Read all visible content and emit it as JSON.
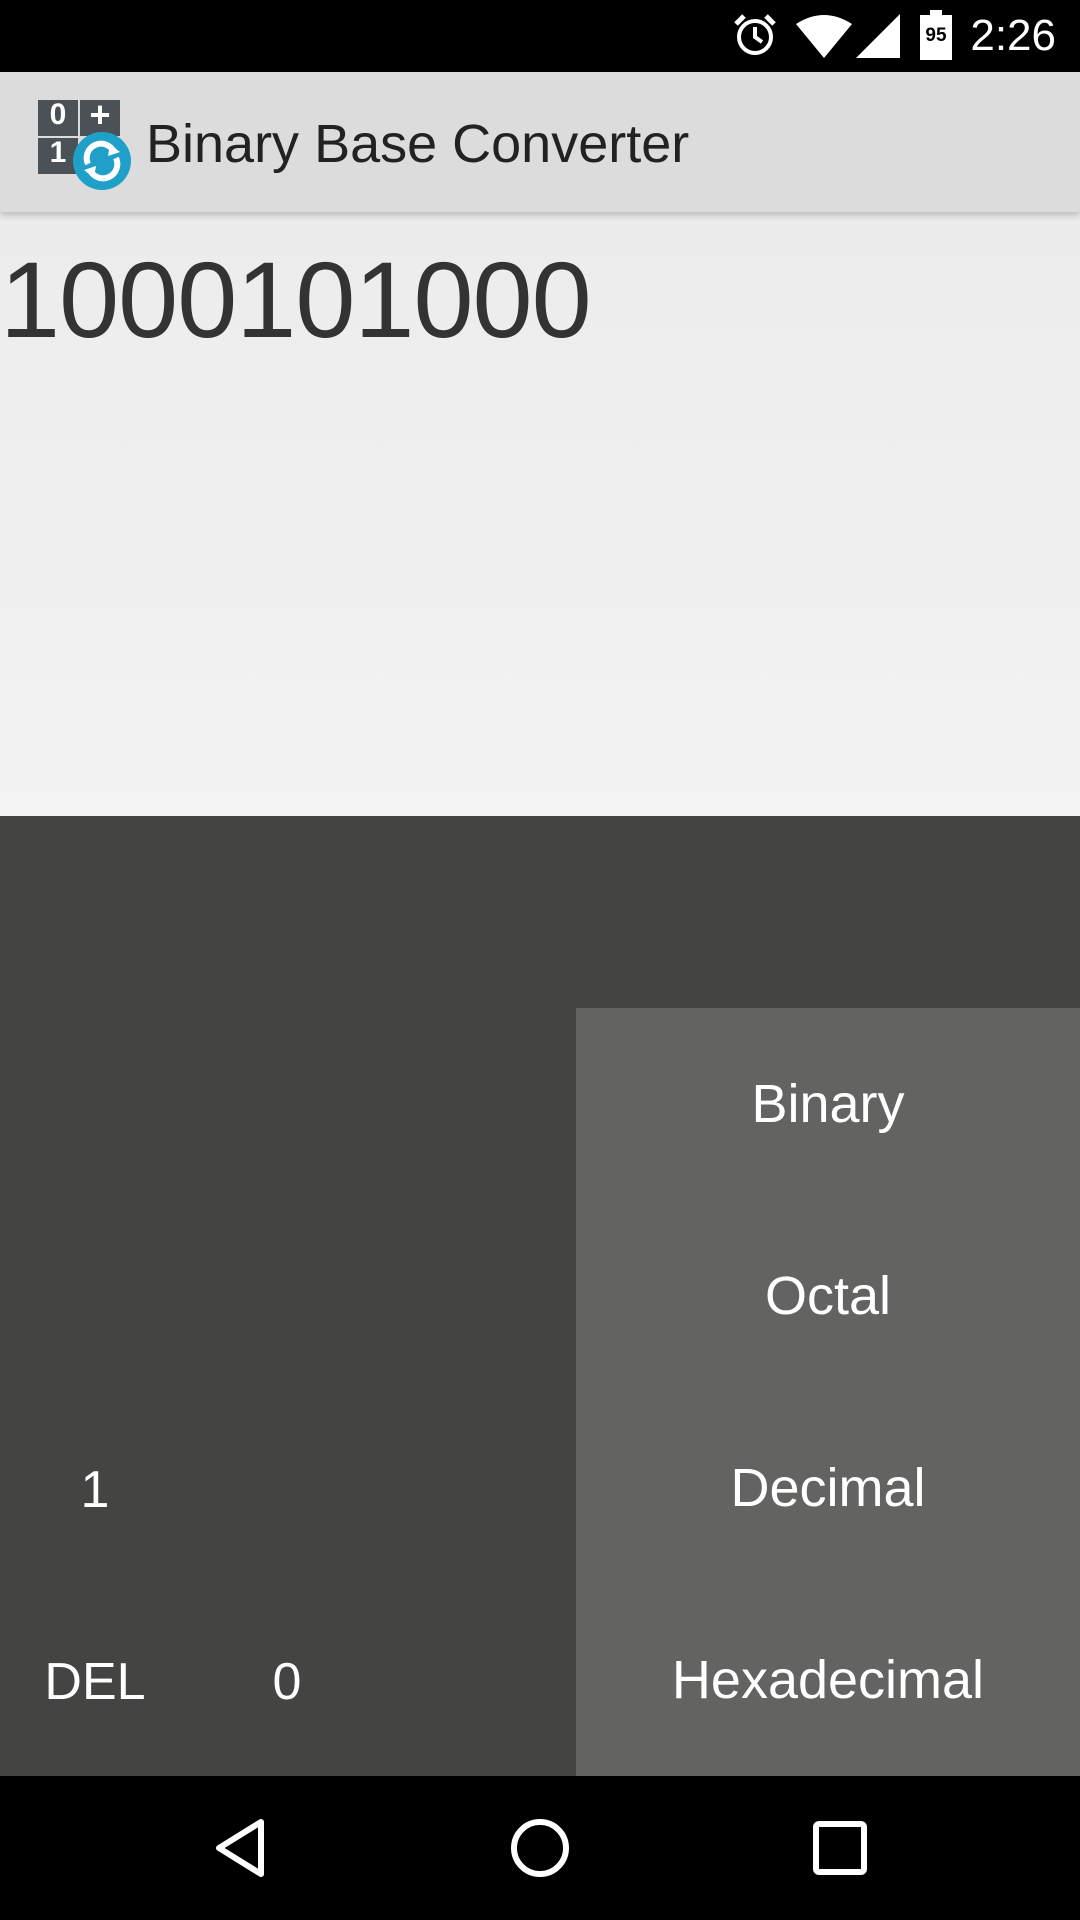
{
  "status_bar": {
    "time": "2:26",
    "battery_level": "95",
    "icons": [
      "alarm-icon",
      "wifi-icon",
      "signal-icon",
      "battery-icon"
    ]
  },
  "app_bar": {
    "title": "Binary Base Converter",
    "icon_digits": [
      "0",
      "+",
      "1"
    ]
  },
  "display": {
    "value": "1000101000"
  },
  "keypad": {
    "one_label": "1",
    "del_label": "DEL",
    "zero_label": "0"
  },
  "base_panel": {
    "options": [
      "Binary",
      "Octal",
      "Decimal",
      "Hexadecimal"
    ]
  },
  "nav_bar": {
    "buttons": [
      "back-icon",
      "home-icon",
      "recents-icon"
    ]
  },
  "colors": {
    "app_bar_bg": "#dcdcdc",
    "keypad_bg": "#444442",
    "base_panel_bg": "#636362",
    "icon_accent": "#1fa0c8"
  }
}
